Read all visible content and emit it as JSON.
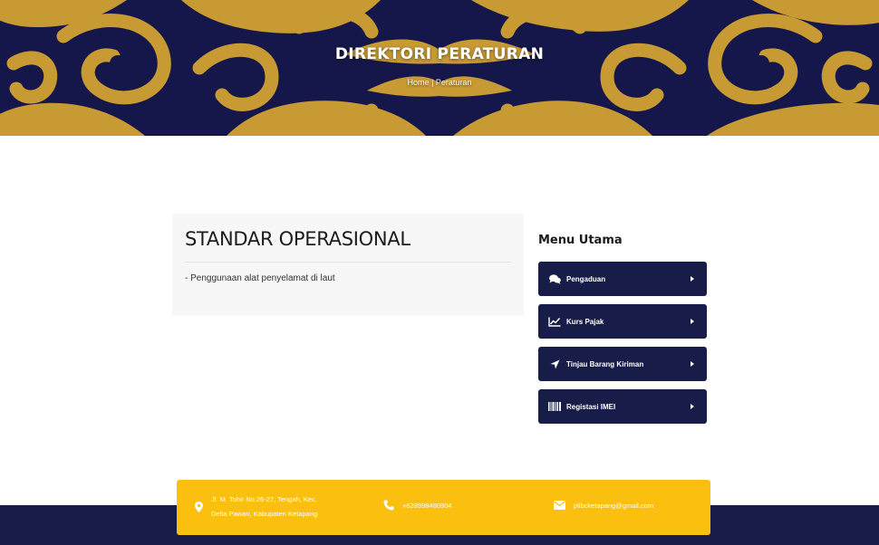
{
  "hero": {
    "title": "DIREKTORI PERATURAN",
    "breadcrumb": {
      "home": "Home",
      "separator": " | ",
      "current": "Peraturan"
    },
    "pattern_colors": {
      "gold": "#c89a33",
      "navy": "#15174a"
    }
  },
  "content": {
    "title": "STANDAR OPERASIONAL",
    "items": [
      "- Penggunaan alat penyelamat di laut"
    ]
  },
  "sidebar": {
    "heading": "Menu Utama",
    "items": [
      {
        "label": "Pengaduan",
        "icon": "comments-icon"
      },
      {
        "label": "Kurs Pajak",
        "icon": "line-chart-icon"
      },
      {
        "label": "Tinjau Barang Kiriman",
        "icon": "location-arrow-icon"
      },
      {
        "label": "Registasi IMEI",
        "icon": "barcode-icon"
      }
    ]
  },
  "footer": {
    "address_line1": "Jl. M. Tohir No.26-27, Tengah, Kec.",
    "address_line2": "Delta Pawan, Kabupaten Ketapang",
    "phone": "+628998480904",
    "email": "plibcketapang@gmail.com",
    "colors": {
      "contact_bar": "#fbbf0f",
      "footer_band": "#171c48"
    }
  },
  "colors": {
    "menu_button": "#171c48",
    "card_bg": "#f7f7f7"
  }
}
